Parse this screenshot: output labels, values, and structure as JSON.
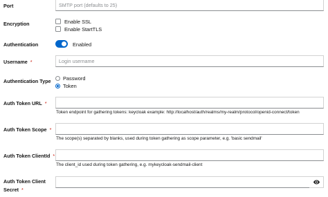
{
  "port": {
    "label": "Port",
    "placeholder": "SMTP port (defaults to 25)"
  },
  "encryption": {
    "label": "Encryption",
    "ssl_label": "Enable SSL",
    "starttls_label": "Enable StartTLS"
  },
  "authentication": {
    "label": "Authentication",
    "toggle_label": "Enabled",
    "enabled": true
  },
  "username": {
    "label": "Username",
    "required_mark": "*",
    "placeholder": "Login username"
  },
  "auth_type": {
    "label": "Authentication Type",
    "options": [
      "Password",
      "Token"
    ],
    "selected": "Token"
  },
  "token_url": {
    "label": "Auth Token URL",
    "required_mark": "*",
    "help": "Token endpoint for gathering tokens: keycloak example: http://localhost/auth/realms/my-realm/protocol/openid-connect/token"
  },
  "token_scope": {
    "label": "Auth Token Scope",
    "required_mark": "*",
    "help": "The scope(s) separated by blanks, used during token gathering as scope parameter, e.g. 'basic sendmail'"
  },
  "client_id": {
    "label": "Auth Token ClientId",
    "required_mark": "*",
    "help": "The client_id used during token gathering, e.g. mykeycloak-sendmail-client"
  },
  "client_secret": {
    "label_line1": "Auth Token Client",
    "label_line2": "Secret",
    "required_mark": "*",
    "icon": "eye-icon"
  },
  "colors": {
    "accent": "#0066cc",
    "required": "#c9190b",
    "border": "#d2d2d2"
  }
}
